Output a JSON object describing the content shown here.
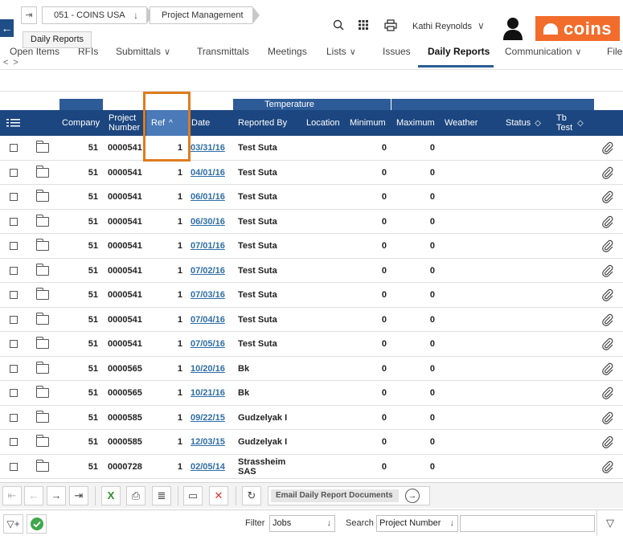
{
  "breadcrumb": {
    "company": "051 - COINS USA",
    "module": "Project Management",
    "tooltip": "Daily Reports"
  },
  "user": {
    "name": "Kathi Reynolds"
  },
  "logo": {
    "text": "COINS",
    "color": "#f26c2b"
  },
  "tabs": [
    {
      "label": "Open Items"
    },
    {
      "label": "RFIs"
    },
    {
      "label": "Submittals"
    },
    {
      "label": "Transmittals"
    },
    {
      "label": "Meetings"
    },
    {
      "label": "Lists"
    },
    {
      "label": "Issues"
    },
    {
      "label": "Daily Reports"
    },
    {
      "label": "Communication"
    },
    {
      "label": "Files"
    }
  ],
  "active_tab": "Daily Reports",
  "grid": {
    "group_header": "Temperature",
    "columns": {
      "company": "Company",
      "project_number": "Project Number",
      "ref": "Ref",
      "date": "Date",
      "reported_by": "Reported By",
      "location": "Location",
      "minimum": "Minimum",
      "maximum": "Maximum",
      "weather": "Weather",
      "status": "Status",
      "tb_test": "Tb Test"
    },
    "sorted_column": "Ref",
    "rows": [
      {
        "company": "51",
        "project": "0000541",
        "ref": "1",
        "date": "03/31/16",
        "reported_by": "Test Suta",
        "location": "",
        "min": "0",
        "max": "0",
        "weather": "",
        "status": ""
      },
      {
        "company": "51",
        "project": "0000541",
        "ref": "1",
        "date": "04/01/16",
        "reported_by": "Test Suta",
        "location": "",
        "min": "0",
        "max": "0",
        "weather": "",
        "status": ""
      },
      {
        "company": "51",
        "project": "0000541",
        "ref": "1",
        "date": "06/01/16",
        "reported_by": "Test Suta",
        "location": "",
        "min": "0",
        "max": "0",
        "weather": "",
        "status": ""
      },
      {
        "company": "51",
        "project": "0000541",
        "ref": "1",
        "date": "06/30/16",
        "reported_by": "Test Suta",
        "location": "",
        "min": "0",
        "max": "0",
        "weather": "",
        "status": ""
      },
      {
        "company": "51",
        "project": "0000541",
        "ref": "1",
        "date": "07/01/16",
        "reported_by": "Test Suta",
        "location": "",
        "min": "0",
        "max": "0",
        "weather": "",
        "status": ""
      },
      {
        "company": "51",
        "project": "0000541",
        "ref": "1",
        "date": "07/02/16",
        "reported_by": "Test Suta",
        "location": "",
        "min": "0",
        "max": "0",
        "weather": "",
        "status": ""
      },
      {
        "company": "51",
        "project": "0000541",
        "ref": "1",
        "date": "07/03/16",
        "reported_by": "Test Suta",
        "location": "",
        "min": "0",
        "max": "0",
        "weather": "",
        "status": ""
      },
      {
        "company": "51",
        "project": "0000541",
        "ref": "1",
        "date": "07/04/16",
        "reported_by": "Test Suta",
        "location": "",
        "min": "0",
        "max": "0",
        "weather": "",
        "status": ""
      },
      {
        "company": "51",
        "project": "0000541",
        "ref": "1",
        "date": "07/05/16",
        "reported_by": "Test Suta",
        "location": "",
        "min": "0",
        "max": "0",
        "weather": "",
        "status": ""
      },
      {
        "company": "51",
        "project": "0000565",
        "ref": "1",
        "date": "10/20/16",
        "reported_by": "Bk",
        "location": "",
        "min": "0",
        "max": "0",
        "weather": "",
        "status": ""
      },
      {
        "company": "51",
        "project": "0000565",
        "ref": "1",
        "date": "10/21/16",
        "reported_by": "Bk",
        "location": "",
        "min": "0",
        "max": "0",
        "weather": "",
        "status": ""
      },
      {
        "company": "51",
        "project": "0000585",
        "ref": "1",
        "date": "09/22/15",
        "reported_by": "Gudzelyak I",
        "location": "",
        "min": "0",
        "max": "0",
        "weather": "",
        "status": ""
      },
      {
        "company": "51",
        "project": "0000585",
        "ref": "1",
        "date": "12/03/15",
        "reported_by": "Gudzelyak I",
        "location": "",
        "min": "0",
        "max": "0",
        "weather": "",
        "status": ""
      },
      {
        "company": "51",
        "project": "0000728",
        "ref": "1",
        "date": "02/05/14",
        "reported_by": "Strassheim SAS",
        "location": "",
        "min": "0",
        "max": "0",
        "weather": "",
        "status": ""
      }
    ]
  },
  "bottom_toolbar": {
    "email_documents": "Email Daily Report Documents"
  },
  "filter_bar": {
    "filter_label": "Filter",
    "filter_value": "Jobs",
    "search_label": "Search",
    "search_field": "Project Number",
    "search_value": ""
  },
  "colors": {
    "header_dark": "#1c467f",
    "group_header": "#2d5b97",
    "sorted_column": "#4a7ab8",
    "highlight_box": "#e07b1f",
    "date_link": "#2e6ea6"
  }
}
